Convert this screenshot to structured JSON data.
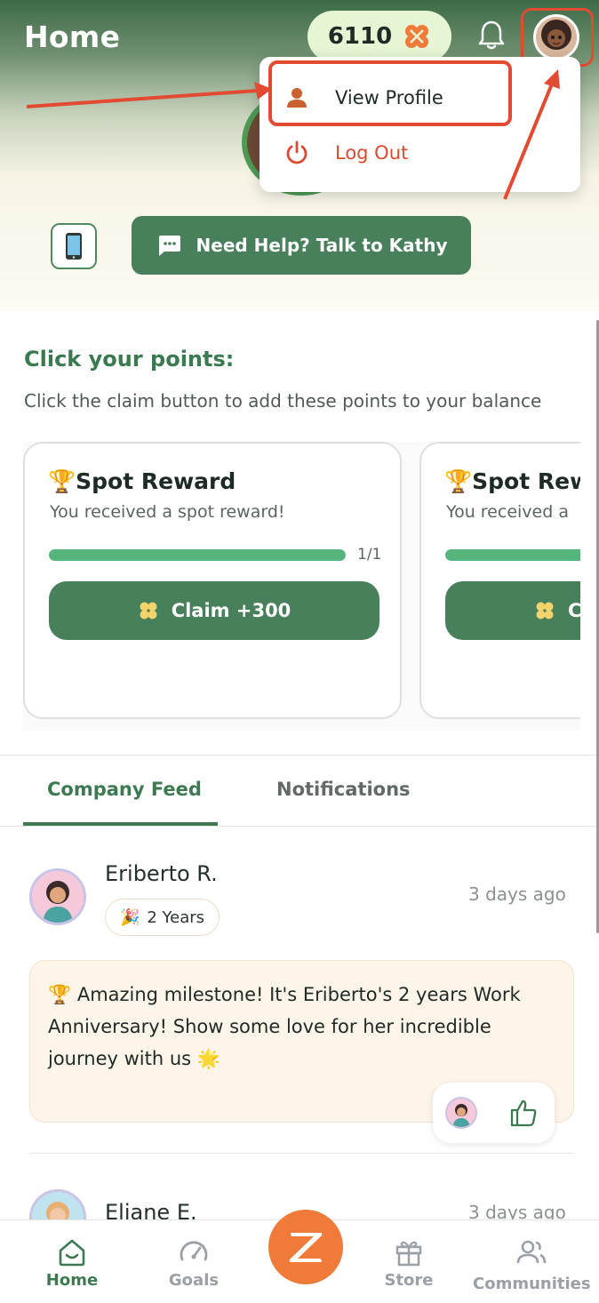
{
  "header": {
    "title": "Home",
    "points": "6110"
  },
  "menu": {
    "view_profile": "View Profile",
    "log_out": "Log Out"
  },
  "help": {
    "label": "Need Help? Talk to Kathy"
  },
  "claim_section": {
    "title": "Click your points:",
    "subtitle": "Click the claim button to add these points to your balance"
  },
  "reward_cards": [
    {
      "title": "Spot Reward",
      "subtitle": "You received a spot reward!",
      "progress": 1.0,
      "progress_text": "1/1",
      "claim_label": "Claim +300"
    },
    {
      "title": "Spot Rew",
      "subtitle": "You received a",
      "progress": 1.0,
      "claim_label": "C"
    }
  ],
  "tabs": {
    "company_feed": "Company Feed",
    "notifications": "Notifications"
  },
  "posts": [
    {
      "name": "Eriberto R.",
      "time": "3 days ago",
      "badge": "2 Years",
      "text": "Amazing milestone! It's Eriberto's 2 years Work Anniversary! Show some love for her incredible journey with us"
    },
    {
      "name": "Eliane E.",
      "time": "3 days ago"
    }
  ],
  "nav": {
    "home": "Home",
    "goals": "Goals",
    "store": "Store",
    "communities": "Communities"
  },
  "colors": {
    "primary_green": "#47805a",
    "accent_orange": "#f07a3a",
    "annotation_red": "#e24a32"
  }
}
